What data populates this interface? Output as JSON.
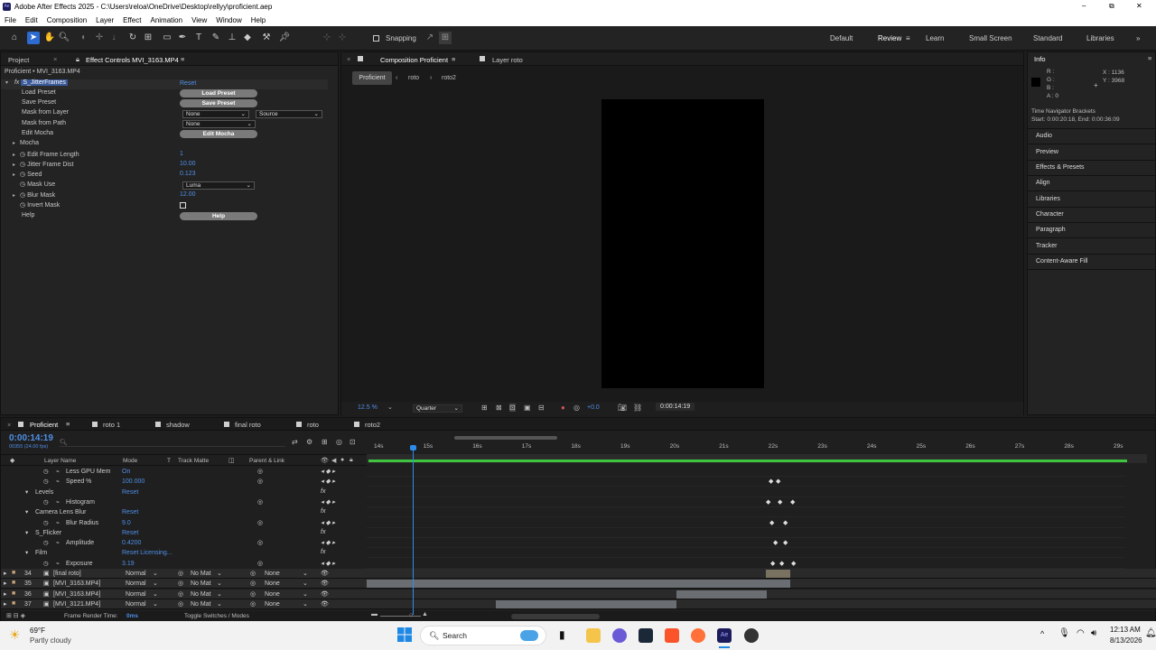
{
  "app": {
    "title": "Adobe After Effects 2025 - C:\\Users\\reloa\\OneDrive\\Desktop\\rellyy\\proficient.aep",
    "menu": [
      "File",
      "Edit",
      "Composition",
      "Layer",
      "Effect",
      "Animation",
      "View",
      "Window",
      "Help"
    ],
    "window_controls": [
      "–",
      "⧉",
      "✕"
    ]
  },
  "toolbar": {
    "snapping_label": "Snapping",
    "workspaces": [
      "Default",
      "Review",
      "Learn",
      "Small Screen",
      "Standard",
      "Libraries"
    ],
    "active_workspace": "Review"
  },
  "left_panel": {
    "tabs": [
      "Project",
      "Effect Controls MVI_3163.MP4"
    ],
    "subtitle": "Proficient • MVI_3163.MP4",
    "effect_name": "S_JitterFrames",
    "reset_label": "Reset",
    "rows": [
      {
        "label": "Load Preset",
        "button": "Load Preset"
      },
      {
        "label": "Save Preset",
        "button": "Save Preset"
      },
      {
        "label": "Mask from Layer",
        "dropdown1": "None",
        "dropdown2": "Source"
      },
      {
        "label": "Mask from Path",
        "dropdown1": "None"
      },
      {
        "label": "Edit Mocha",
        "button": "Edit Mocha"
      },
      {
        "label": "Mocha"
      },
      {
        "label": "Edit Frame Length",
        "value": "1"
      },
      {
        "label": "Jitter Frame Dist",
        "value": "10.00"
      },
      {
        "label": "Seed",
        "value": "0.123"
      },
      {
        "label": "Mask Use",
        "dropdown1": "Luma"
      },
      {
        "label": "Blur Mask",
        "value": "12.00"
      },
      {
        "label": "Invert Mask"
      },
      {
        "label": "Help",
        "button": "Help"
      }
    ]
  },
  "comp_panel": {
    "tabs": [
      "Composition Proficient",
      "Layer roto"
    ],
    "breadcrumbs": [
      "Proficient",
      "roto",
      "roto2"
    ],
    "zoom": "12.5 %",
    "resolution": "Quarter",
    "exposure": "+0.0",
    "timecode": "0:00:14:19"
  },
  "right_panel": {
    "title": "Info",
    "rgba": [
      "R :",
      "G :",
      "B :",
      "A : 0"
    ],
    "coords": [
      "X : 1136",
      "Y : 3968"
    ],
    "nav_title": "Time Navigator Brackets",
    "nav_range": "Start: 0:00:20:18, End: 0:00:36:09",
    "items": [
      "Audio",
      "Preview",
      "Effects & Presets",
      "Align",
      "Libraries",
      "Character",
      "Paragraph",
      "Tracker",
      "Content-Aware Fill"
    ]
  },
  "timeline": {
    "tabs": [
      "Proficient",
      "roto 1",
      "shadow",
      "final roto",
      "roto",
      "roto2"
    ],
    "timecode": "0:00:14:19",
    "frame_info": "00355 (24.00 fps)",
    "search_placeholder": "",
    "columns": [
      "Layer Name",
      "Mode",
      "T",
      "Track Matte",
      "Parent & Link"
    ],
    "ruler": [
      "14s",
      "15s",
      "16s",
      "17s",
      "18s",
      "19s",
      "20s",
      "21s",
      "22s",
      "23s",
      "24s",
      "25s",
      "26s",
      "27s",
      "28s",
      "29s"
    ],
    "prop_rows": [
      {
        "name": "Less GPU Mem",
        "value": "On",
        "indent": 3
      },
      {
        "name": "Speed %",
        "value": "100.000",
        "indent": 3
      },
      {
        "name": "Levels",
        "value": "Reset",
        "indent": 2
      },
      {
        "name": "Histogram",
        "value": "",
        "indent": 3
      },
      {
        "name": "Camera Lens Blur",
        "value": "Reset",
        "indent": 2
      },
      {
        "name": "Blur Radius",
        "value": "9.0",
        "indent": 3
      },
      {
        "name": "S_Flicker",
        "value": "Reset",
        "indent": 2
      },
      {
        "name": "Amplitude",
        "value": "0.4200",
        "indent": 3
      },
      {
        "name": "Film",
        "value": "Reset   Licensing...",
        "indent": 2
      },
      {
        "name": "Exposure",
        "value": "3.19",
        "indent": 3
      }
    ],
    "layers": [
      {
        "num": "34",
        "name": "[final roto]",
        "mode": "Normal",
        "matte": "No Mat",
        "parent": "None"
      },
      {
        "num": "35",
        "name": "[MVI_3163.MP4]",
        "mode": "Normal",
        "matte": "No Mat",
        "parent": "None"
      },
      {
        "num": "36",
        "name": "[MVI_3163.MP4]",
        "mode": "Normal",
        "matte": "No Mat",
        "parent": "None"
      },
      {
        "num": "37",
        "name": "[MVI_3121.MP4]",
        "mode": "Normal",
        "matte": "No Mat",
        "parent": "None"
      }
    ],
    "footer_render": "Frame Render Time:",
    "footer_ms": "0ms",
    "toggle_label": "Toggle Switches / Modes"
  },
  "taskbar": {
    "weather_temp": "69°F",
    "weather_desc": "Partly cloudy",
    "search": "Search",
    "time": "12:13 AM",
    "date": "8/13/2026"
  },
  "colors": {
    "accent": "#2d8ceb",
    "keyframe_line": "#3ec43e"
  }
}
